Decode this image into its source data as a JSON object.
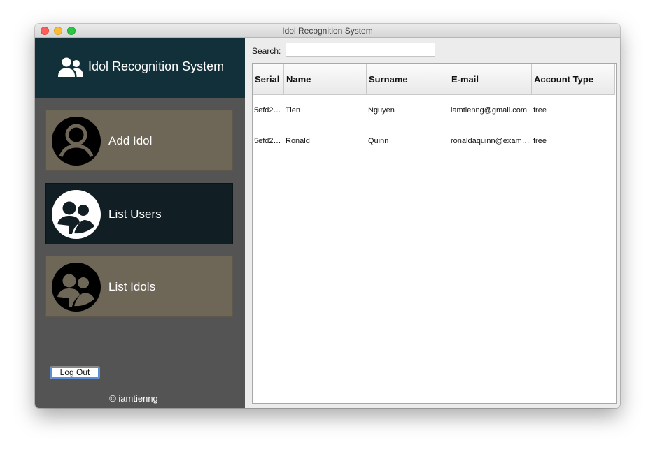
{
  "window": {
    "title": "Idol Recognition System"
  },
  "sidebar": {
    "brand": "Idol Recognition System",
    "items": [
      {
        "label": "Add Idol",
        "icon": "user-circle-icon",
        "active": false
      },
      {
        "label": "List Users",
        "icon": "users-circle-icon",
        "active": true
      },
      {
        "label": "List Idols",
        "icon": "users-circle-icon",
        "active": false
      }
    ],
    "logout_label": "Log Out",
    "copyright": "© iamtienng"
  },
  "main": {
    "search": {
      "label": "Search:",
      "value": "",
      "placeholder": ""
    },
    "table": {
      "columns": [
        "Serial",
        "Name",
        "Surname",
        "E-mail",
        "Account Type"
      ],
      "rows": [
        [
          "5efd2…",
          "Tien",
          "Nguyen",
          "iamtienng@gmail.com",
          "free"
        ],
        [
          "5efd2…",
          "Ronald",
          "Quinn",
          "ronaldaquinn@exam…",
          "free"
        ]
      ]
    }
  },
  "colors": {
    "sidebar_bg": "#545454",
    "brand_bg": "#11303a",
    "nav_item_bg": "#6e6656",
    "nav_item_active_bg": "#111f24"
  }
}
